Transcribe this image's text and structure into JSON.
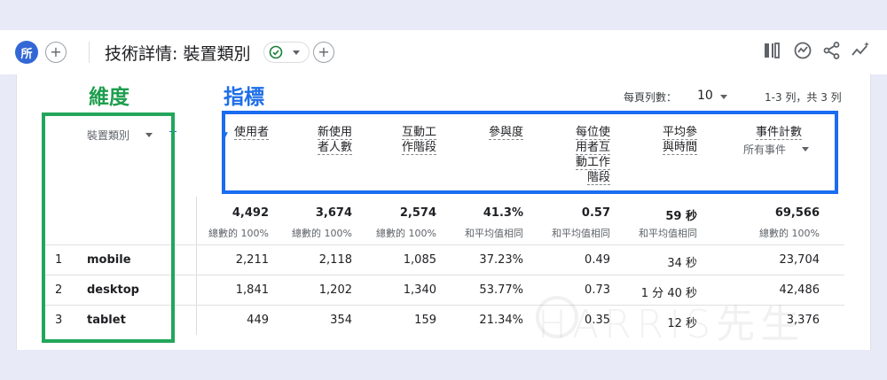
{
  "header": {
    "avatar_label": "所",
    "add_label": "+",
    "title": "技術詳情: 裝置類別",
    "compare_add_label": "+"
  },
  "annotations": {
    "dimension_label": "維度",
    "metrics_label": "指標",
    "dimension_box_color": "#22a65b",
    "metrics_box_color": "#1a6cf0"
  },
  "pagination": {
    "rows_per_page_label": "每頁列數：",
    "rows_per_page_value": "10",
    "range_text": "1-3 列，共 3 列"
  },
  "table": {
    "dimension_header": "裝置類別",
    "columns": [
      {
        "label": "使用者",
        "total": "4,492",
        "subtotal": "總數的 100%"
      },
      {
        "label": "新使用\n者人數",
        "total": "3,674",
        "subtotal": "總數的 100%"
      },
      {
        "label": "互動工\n作階段",
        "total": "2,574",
        "subtotal": "總數的 100%"
      },
      {
        "label": "參與度",
        "total": "41.3%",
        "subtotal": "和平均值相同"
      },
      {
        "label": "每位使\n用者互\n動工作\n階段",
        "total": "0.57",
        "subtotal": "和平均值相同"
      },
      {
        "label": "平均參\n與時間",
        "total": "59 秒",
        "subtotal": "和平均值相同"
      },
      {
        "label": "事件計數",
        "total": "69,566",
        "subtotal": "總數的 100%"
      }
    ],
    "event_filter": "所有事件",
    "rows": [
      {
        "num": "1",
        "name": "mobile",
        "values": [
          "2,211",
          "2,118",
          "1,085",
          "37.23%",
          "0.49",
          "34 秒",
          "23,704"
        ]
      },
      {
        "num": "2",
        "name": "desktop",
        "values": [
          "1,841",
          "1,202",
          "1,340",
          "53.77%",
          "0.73",
          "1 分 40 秒",
          "42,486"
        ]
      },
      {
        "num": "3",
        "name": "tablet",
        "values": [
          "449",
          "354",
          "159",
          "21.34%",
          "0.35",
          "12 秒",
          "3,376"
        ]
      }
    ]
  },
  "watermark": "HARRIS先生",
  "colors": {
    "accent": "#1a73e8",
    "avatar_bg": "#3367d6",
    "check_green": "#188038"
  }
}
